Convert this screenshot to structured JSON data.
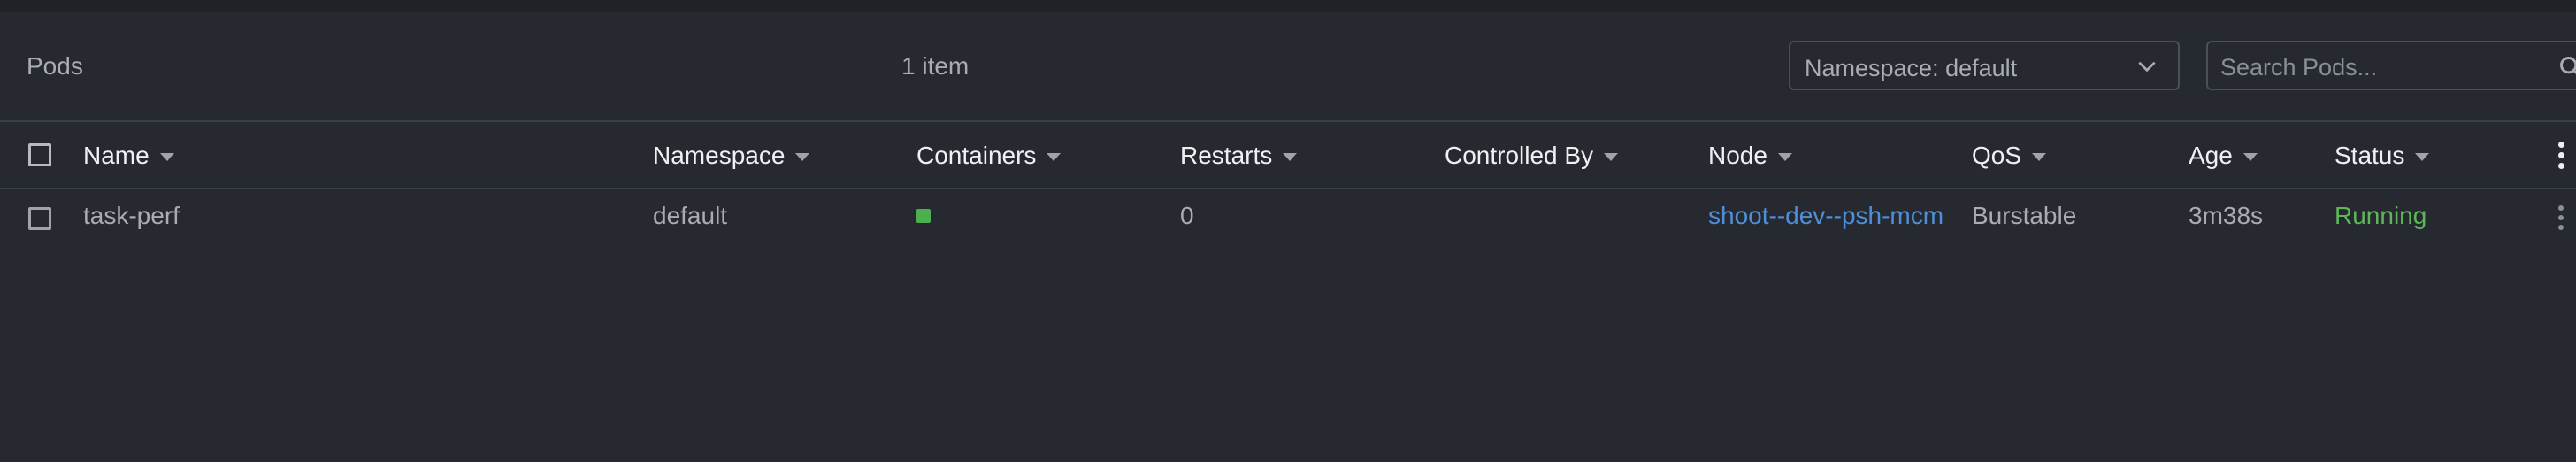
{
  "header": {
    "title": "Pods",
    "count": "1 item",
    "namespace_select": "Namespace: default",
    "search_placeholder": "Search Pods..."
  },
  "columns": [
    {
      "key": "name",
      "label": "Name"
    },
    {
      "key": "namespace",
      "label": "Namespace"
    },
    {
      "key": "containers",
      "label": "Containers"
    },
    {
      "key": "restarts",
      "label": "Restarts"
    },
    {
      "key": "controlled_by",
      "label": "Controlled By"
    },
    {
      "key": "node",
      "label": "Node"
    },
    {
      "key": "qos",
      "label": "QoS"
    },
    {
      "key": "age",
      "label": "Age"
    },
    {
      "key": "status",
      "label": "Status"
    }
  ],
  "rows": [
    {
      "name": "task-perf",
      "namespace": "default",
      "containers_status": "running",
      "restarts": "0",
      "controlled_by": "",
      "node": "shoot--dev--psh-mcm",
      "qos": "Burstable",
      "age": "3m38s",
      "status": "Running"
    }
  ],
  "colors": {
    "background": "#262a30",
    "link": "#4f8ed8",
    "running": "#5fb55a",
    "container_ok": "#4caf50"
  },
  "icons": {
    "namespace_dropdown": "chevron-down-icon",
    "search": "search-icon",
    "menu": "kebab-menu-icon",
    "sort": "caret-down-icon"
  }
}
